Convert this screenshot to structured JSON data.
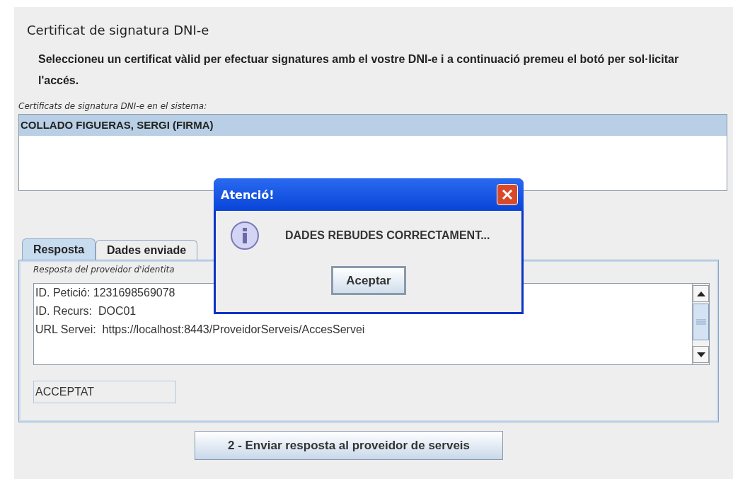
{
  "title": "Certificat de signatura DNI-e",
  "instructions": "Seleccioneu un certificat vàlid per efectuar signatures amb el vostre DNI-e i a continuació premeu el botó per sol·licitar l'accés.",
  "certificates_label": "Certificats de signatura DNI-e en el sistema:",
  "certificates": [
    {
      "name": "COLLADO FIGUERAS, SERGI (FIRMA)",
      "selected": true
    }
  ],
  "tabs": [
    {
      "label": "Resposta",
      "selected": true
    },
    {
      "label": "Dades enviade",
      "selected": false
    }
  ],
  "response_caption": "Resposta del proveidor d'identita",
  "response_lines": [
    "ID. Petició: 1231698569078",
    "ID. Recurs:  DOC01",
    "URL Servei:  https://localhost:8443/ProveidorServeis/AccesServei"
  ],
  "status_value": "ACCEPTAT",
  "send_button": "2 - Enviar resposta al proveidor de serveis",
  "dialog": {
    "title": "Atenció!",
    "message": "DADES REBUDES CORRECTAMENT...",
    "button": "Aceptar"
  }
}
